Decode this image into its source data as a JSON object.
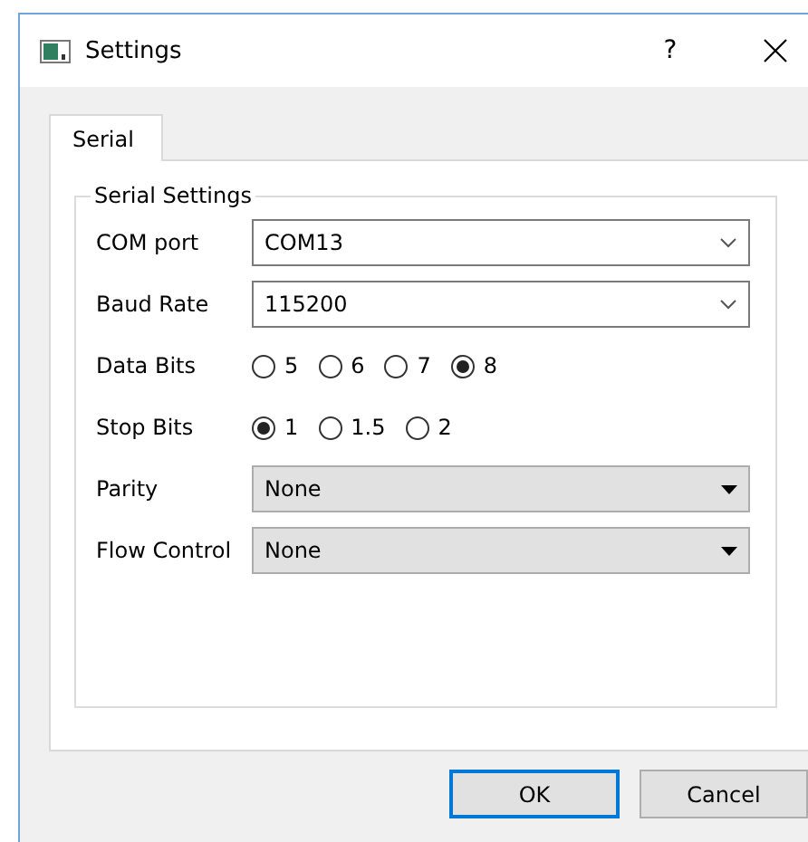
{
  "window": {
    "title": "Settings",
    "help": "?"
  },
  "tabs": [
    {
      "label": "Serial",
      "selected": true
    }
  ],
  "group": {
    "title": "Serial Settings"
  },
  "rows": [
    {
      "kind": "combo",
      "label": "COM port",
      "value": "COM13"
    },
    {
      "kind": "combo",
      "label": "Baud Rate",
      "value": "115200"
    },
    {
      "kind": "radio",
      "label": "Data Bits",
      "options": [
        {
          "label": "5",
          "selected": false
        },
        {
          "label": "6",
          "selected": false
        },
        {
          "label": "7",
          "selected": false
        },
        {
          "label": "8",
          "selected": true
        }
      ]
    },
    {
      "kind": "radio",
      "label": "Stop Bits",
      "options": [
        {
          "label": "1",
          "selected": true
        },
        {
          "label": "1.5",
          "selected": false
        },
        {
          "label": "2",
          "selected": false
        }
      ]
    },
    {
      "kind": "select",
      "label": "Parity",
      "value": "None"
    },
    {
      "kind": "select",
      "label": "Flow Control",
      "value": "None"
    }
  ],
  "buttons": [
    {
      "label": "OK",
      "default": true
    },
    {
      "label": "Cancel",
      "default": false
    }
  ]
}
